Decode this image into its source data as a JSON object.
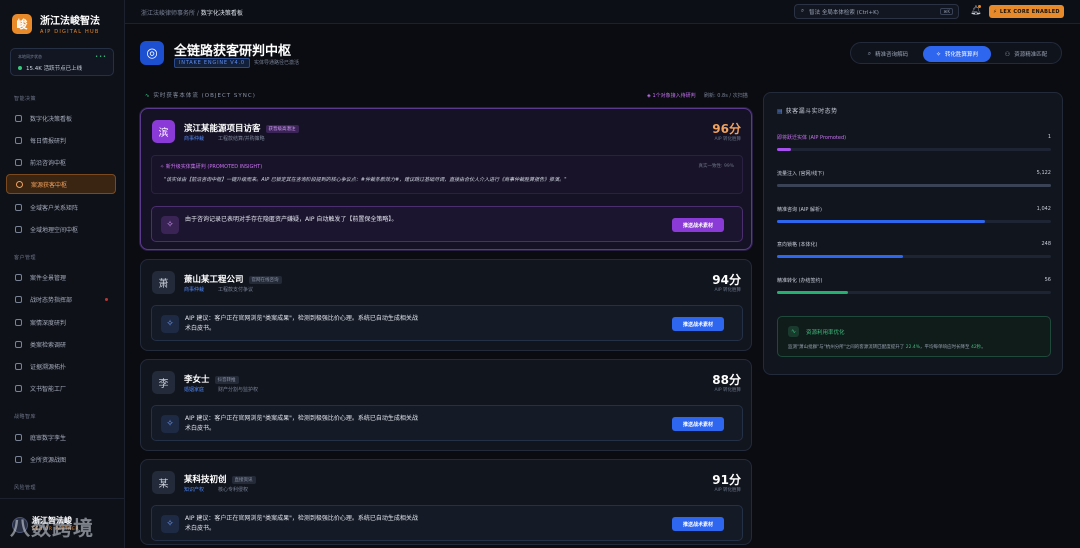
{
  "brand": {
    "logo": "峻",
    "title": "浙江法峻智法",
    "subtitle": "AIP DIGITAL HUB"
  },
  "node": {
    "label": "本地同步状态",
    "value": "15.4K 活跃节点已上线"
  },
  "sidebar": {
    "sections": [
      {
        "label": "智能决策"
      },
      {
        "label": "客户管理"
      },
      {
        "label": "战略智库"
      },
      {
        "label": "风险管理"
      }
    ],
    "items": [
      {
        "label": "数字化决策看板",
        "icon": "dashboard-icon",
        "active": false
      },
      {
        "label": "每日情报研判",
        "icon": "document-icon",
        "active": false
      },
      {
        "label": "前沿咨询中枢",
        "icon": "chat-icon",
        "active": false
      },
      {
        "label": "案源获客中枢",
        "icon": "target-icon",
        "active": true
      },
      {
        "label": "全域客户关系矩阵",
        "icon": "network-icon",
        "active": false
      },
      {
        "label": "全域地理空间中枢",
        "icon": "map-icon",
        "active": false
      },
      {
        "label": "案件全景管理",
        "icon": "folder-icon",
        "active": false
      },
      {
        "label": "战时态势指挥部",
        "icon": "radar-icon",
        "active": false
      },
      {
        "label": "案情深度研判",
        "icon": "analysis-icon",
        "active": false
      },
      {
        "label": "类案检索调研",
        "icon": "search-icon",
        "active": false
      },
      {
        "label": "证据溯源拓扑",
        "icon": "topology-icon",
        "active": false
      },
      {
        "label": "文书智能工厂",
        "icon": "file-icon",
        "active": false
      },
      {
        "label": "庭审数字孪生",
        "icon": "court-icon",
        "active": false
      },
      {
        "label": "全所资源战图",
        "icon": "grid-icon",
        "active": false
      }
    ]
  },
  "footer": {
    "name": "浙江智法峻",
    "sub": "SENIOR PARTNER",
    "watermark": "八数跨境"
  },
  "topbar": {
    "crumb_root": "浙江法峻律师事务所 /",
    "crumb_current": "数字化决策看板",
    "search_placeholder": "智法 全局本体检索 (Ctrl+K)",
    "search_kbd": "⌘K",
    "lex": "LEX CORE ENABLED"
  },
  "hero": {
    "icon": "target-icon",
    "title": "全链路获客研判中枢",
    "tag": "INTAKE ENGINE V4.0",
    "sub": "实体导通路径已激活"
  },
  "tabs": [
    {
      "label": "精准咨询解码",
      "icon": "search-icon",
      "active": false
    },
    {
      "label": "转化胜算算判",
      "icon": "spark-icon",
      "active": true
    },
    {
      "label": "资源精准匹配",
      "icon": "user-icon",
      "active": false
    }
  ],
  "strip": {
    "left": "实时获客本体流 (OBJECT SYNC)",
    "right_alert": "1个对象接入待研判",
    "right_meta": "刷新: 0.8s / 次扫描"
  },
  "leads": [
    {
      "avatar": "滨",
      "name": "滨江某能源项目访客",
      "badge": "获晋级高潜注",
      "category": "商事仲裁",
      "desc": "工程款结算/并购策略",
      "score": "96分",
      "score_label": "AIP 转化胜算",
      "highlight": true,
      "insight_title": "新升级实体集研判 (PROMOTED INSIGHT)",
      "insight_meta": "真实一致性: 99%",
      "insight_quote": "\"该实体由【前沿咨询中枢】一键升级而来。AIP 已锁定其在咨询阶段提到的核心争议点：#仲裁条款效力#，建议跳过基础尽调，直接由合伙人介入进行《商事仲裁胜算报告》推演。\"",
      "suggestion": "由于咨询记录已表明对手存在隐匿资产嫌疑，AIP 自动触发了【前置保全策略】。",
      "button": "推送战术素材"
    },
    {
      "avatar": "萧",
      "name": "萧山某工程公司",
      "badge": "官网在线咨询",
      "category": "商事仲裁",
      "desc": "工程款支付争议",
      "score": "94分",
      "score_label": "AIP 转化胜算",
      "highlight": false,
      "suggestion": "AIP 建议：客户正在官网浏览\"类案成果\"，检测到极强比价心理。系统已自动生成相关战术白皮书。",
      "button": "推送战术素材"
    },
    {
      "avatar": "李",
      "name": "李女士",
      "badge": "抖音转推",
      "category": "婚姻家庭",
      "desc": "财产分割与监护权",
      "score": "88分",
      "score_label": "AIP 转化胜算",
      "highlight": false,
      "suggestion": "AIP 建议：客户正在官网浏览\"类案成果\"，检测到极强比价心理。系统已自动生成相关战术白皮书。",
      "button": "推送战术素材"
    },
    {
      "avatar": "某",
      "name": "某科技初创",
      "badge": "直接资讯",
      "category": "知识产权",
      "desc": "核心专利侵权",
      "score": "91分",
      "score_label": "AIP 转化胜算",
      "highlight": false,
      "suggestion": "AIP 建议：客户正在官网浏览\"类案成果\"，检测到极强比价心理。系统已自动生成相关战术白皮书。",
      "button": "推送战术素材"
    }
  ],
  "funnel": {
    "title": "获客漏斗实时态势",
    "rows": [
      {
        "label": "即将跃迁实体 (AIP Promoted)",
        "value": "1",
        "pct": 0.05,
        "color": "#a84ff0"
      },
      {
        "label": "流量注入 (官网/线下)",
        "value": "5,122",
        "pct": 1.0,
        "color": "#3a4256"
      },
      {
        "label": "精准咨询 (AIP 解析)",
        "value": "1,042",
        "pct": 0.76,
        "color": "#2f66f0"
      },
      {
        "label": "意向锁格 (本体化)",
        "value": "248",
        "pct": 0.46,
        "color": "#2f66f0"
      },
      {
        "label": "精准转化 (办结签约)",
        "value": "56",
        "pct": 0.26,
        "color": "#25b070"
      }
    ],
    "opt_title": "资源利用率优化",
    "opt_desc_a": "监测\"萧山批群\"与\"杭州分所\"之间的客源流转匹配度提升了 ",
    "opt_hl1": "22.4%",
    "opt_desc_b": "，平均每单响应时长降至 ",
    "opt_hl2": "42秒",
    "opt_desc_c": "。"
  }
}
